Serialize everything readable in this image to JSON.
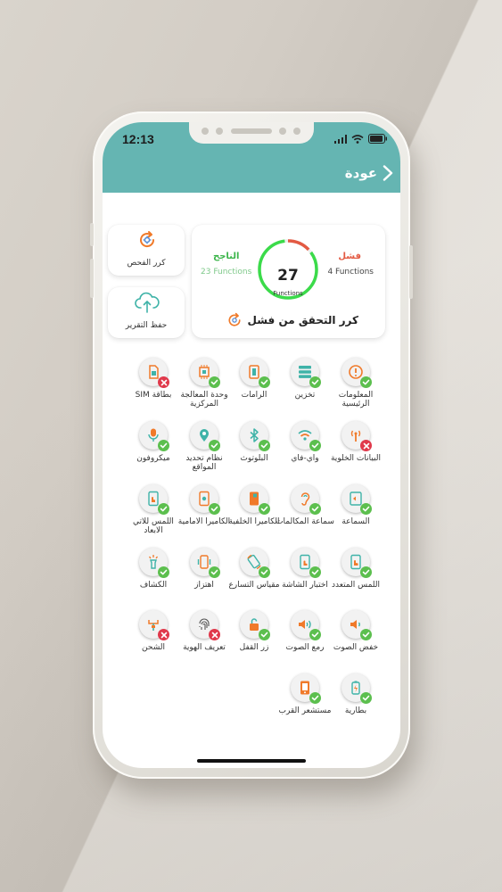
{
  "status_bar": {
    "time": "12:13"
  },
  "header": {
    "back_label": "عودة"
  },
  "actions": {
    "recheck_label": "كرر الفحص",
    "save_label": "حفظ التقرير"
  },
  "summary": {
    "fail_title": "فشل",
    "fail_count": "4 Functions",
    "pass_title": "الناجح",
    "pass_count": "23 Functions",
    "total": "27",
    "total_label": "Functions",
    "recheck_failed_label": "كرر التحقق من فشل",
    "failed": 4,
    "passed": 23
  },
  "colors": {
    "header": "#65b5b2",
    "pass": "#3bb54a",
    "fail": "#e35a43",
    "badge_ok": "#5cbf4e",
    "badge_bad": "#e0394b"
  },
  "tests": [
    {
      "label": "المعلومات الرئيسية",
      "icon": "info-icon",
      "status": "pass"
    },
    {
      "label": "تخزين",
      "icon": "storage-icon",
      "status": "pass"
    },
    {
      "label": "الرامات",
      "icon": "ram-icon",
      "status": "pass"
    },
    {
      "label": "وحدة المعالجة المركزية",
      "icon": "cpu-icon",
      "status": "pass"
    },
    {
      "label": "بطاقة SIM",
      "icon": "sim-card-icon",
      "status": "fail"
    },
    {
      "label": "البيانات الخلوية",
      "icon": "cellular-icon",
      "status": "fail"
    },
    {
      "label": "واي-فاي",
      "icon": "wifi-icon",
      "status": "pass"
    },
    {
      "label": "البلوتوث",
      "icon": "bluetooth-icon",
      "status": "pass"
    },
    {
      "label": "نظام تحديد المواقع",
      "icon": "location-icon",
      "status": "pass"
    },
    {
      "label": "ميكروفون",
      "icon": "microphone-icon",
      "status": "pass"
    },
    {
      "label": "السماعة",
      "icon": "speaker-icon",
      "status": "pass"
    },
    {
      "label": "سماعة المكالمات",
      "icon": "earpiece-icon",
      "status": "pass"
    },
    {
      "label": "الكاميرا الخلفية",
      "icon": "rear-camera-icon",
      "status": "pass"
    },
    {
      "label": "الكاميرا الامامية",
      "icon": "front-camera-icon",
      "status": "pass"
    },
    {
      "label": "اللمس للاتي الابعاد",
      "icon": "3d-touch-icon",
      "status": "pass"
    },
    {
      "label": "اللمس المتعدد",
      "icon": "multitouch-icon",
      "status": "pass"
    },
    {
      "label": "اختبار الشاشة",
      "icon": "screen-test-icon",
      "status": "pass"
    },
    {
      "label": "مقياس التسارع",
      "icon": "accelerometer-icon",
      "status": "pass"
    },
    {
      "label": "اهتزاز",
      "icon": "vibration-icon",
      "status": "pass"
    },
    {
      "label": "الكشاف",
      "icon": "flashlight-icon",
      "status": "pass"
    },
    {
      "label": "خفض الصوت",
      "icon": "volume-down-icon",
      "status": "pass"
    },
    {
      "label": "رمع الصوت",
      "icon": "volume-up-icon",
      "status": "pass"
    },
    {
      "label": "زر القفل",
      "icon": "lock-button-icon",
      "status": "pass"
    },
    {
      "label": "تعريف الهوية",
      "icon": "fingerprint-icon",
      "status": "fail"
    },
    {
      "label": "الشحن",
      "icon": "charging-icon",
      "status": "fail"
    },
    {
      "label": "بطارية",
      "icon": "battery-icon",
      "status": "pass"
    },
    {
      "label": "مستشعر القرب",
      "icon": "proximity-sensor-icon",
      "status": "pass"
    }
  ]
}
